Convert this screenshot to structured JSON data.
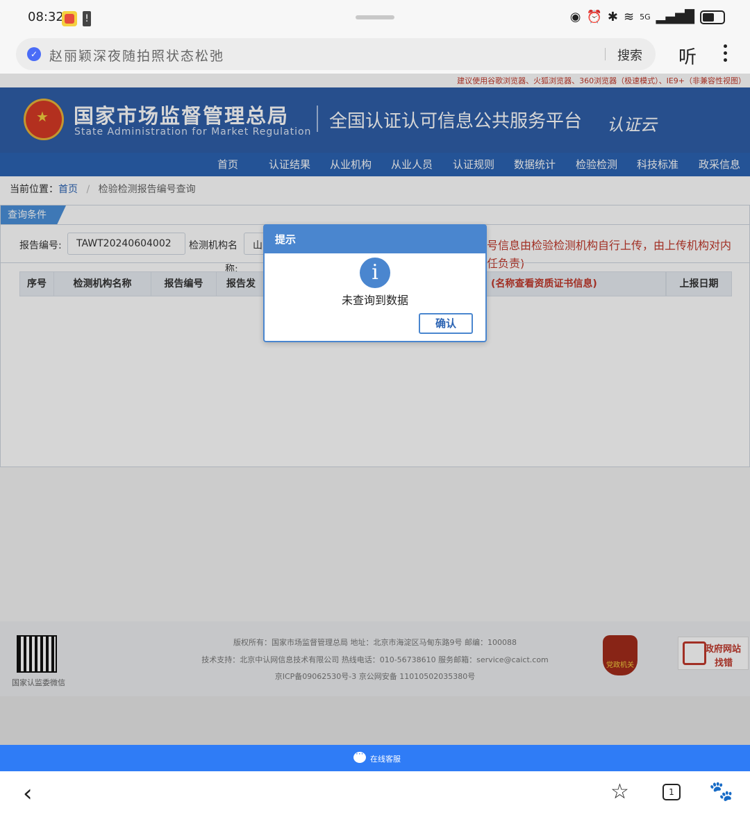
{
  "status": {
    "time": "08:32",
    "network": "5G"
  },
  "address_bar": {
    "query": "赵丽颖深夜随拍照状态松弛",
    "search_label": "搜索",
    "listen_label": "听"
  },
  "page": {
    "browser_tip": "建议使用谷歌浏览器、火狐浏览器、360浏览器（极速模式）、IE9+（非兼容性视图）",
    "org_cn": "国家市场监督管理总局",
    "org_en": "State Administration  for  Market Regulation",
    "platform": "全国认证认可信息公共服务平台",
    "platform_logo": "认证云",
    "nav": [
      "首页",
      "认证结果",
      "从业机构",
      "从业人员",
      "认证规则",
      "数据统计",
      "检验检测",
      "科技标准",
      "政采信息"
    ],
    "breadcrumb": {
      "label": "当前位置：",
      "home": "首页",
      "sep": "/",
      "current": "检验检测报告编号查询"
    },
    "query_tab": "查询条件",
    "report_no_label": "报告编号:",
    "report_no_value": "TAWT20240604002",
    "org_name_label": "检测机构名",
    "org_name_label2": "称:",
    "org_name_value": "山",
    "notice_line1": "号信息由检验检测机构自行上传，由上传机构对内",
    "notice_line2": "任负责)",
    "table_headers": [
      "序号",
      "检测机构名称",
      "报告编号",
      "报告发",
      "(名称查看资质证书信息)",
      "上报日期"
    ]
  },
  "footer": {
    "qr_caption": "国家认监委微信",
    "line1": "版权所有：国家市场监督管理总局    地址：北京市海淀区马甸东路9号    邮编：100088",
    "line2": "技术支持：北京中认网信息技术有限公司    热线电话：010-56738610    服务邮箱：service@caict.com",
    "line3": "京ICP备09062530号-3    京公网安备  11010502035380号",
    "badge": "党政机关",
    "gov_t1": "政府网站",
    "gov_t2": "找错"
  },
  "dialog": {
    "title": "提示",
    "icon": "info-icon",
    "message": "未查询到数据",
    "ok_label": "确认"
  },
  "chat": {
    "label": "在线客服"
  },
  "toolbar": {
    "tab_count": "1"
  },
  "colors": {
    "brand_blue": "#2f5fa8",
    "nav_blue": "#2c64b3",
    "dialog_blue": "#4a86cf",
    "alert_red": "#c0392b",
    "chat_blue": "#2f7cf6"
  }
}
